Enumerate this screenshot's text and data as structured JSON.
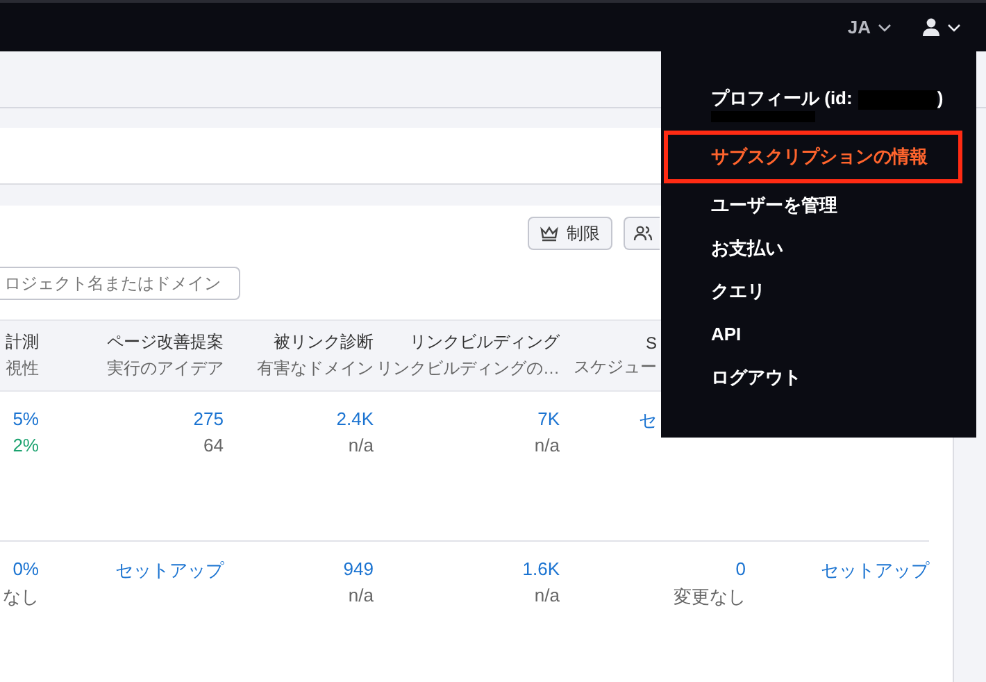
{
  "topbar": {
    "language": "JA"
  },
  "user_menu": {
    "items": [
      {
        "kind": "profile",
        "label": "プロフィール (id:",
        "suffix": ")",
        "selected": false
      },
      {
        "kind": "link",
        "label": "サブスクリプションの情報",
        "selected": true
      },
      {
        "kind": "link",
        "label": "ユーザーを管理",
        "selected": false
      },
      {
        "kind": "link",
        "label": "お支払い",
        "selected": false
      },
      {
        "kind": "link",
        "label": "クエリ",
        "selected": false
      },
      {
        "kind": "link",
        "label": "API",
        "selected": false
      },
      {
        "kind": "link",
        "label": "ログアウト",
        "selected": false
      }
    ]
  },
  "toolbar": {
    "buttons": [
      {
        "kind": "limits",
        "label": "制限"
      },
      {
        "kind": "users"
      }
    ]
  },
  "search": {
    "placeholder": "ロジェクト名またはドメイン"
  },
  "table": {
    "columns": [
      {
        "title": "計測",
        "subtitle": "視性"
      },
      {
        "title": "ページ改善提案",
        "subtitle": "実行のアイデア"
      },
      {
        "title": "被リンク診断",
        "subtitle": "有害なドメイン"
      },
      {
        "title": "リンクビルディング",
        "subtitle": "リンクビルディングの…"
      },
      {
        "title": "S",
        "subtitle": "スケジュー"
      }
    ],
    "rows": [
      {
        "cells": [
          [
            {
              "text": "5%",
              "kind": "link"
            },
            {
              "text": "2%",
              "kind": "positive"
            }
          ],
          [
            {
              "text": "275",
              "kind": "link"
            },
            {
              "text": "64",
              "kind": "muted"
            }
          ],
          [
            {
              "text": "2.4K",
              "kind": "link"
            },
            {
              "text": "n/a",
              "kind": "muted"
            }
          ],
          [
            {
              "text": "7K",
              "kind": "link"
            },
            {
              "text": "n/a",
              "kind": "muted"
            }
          ],
          [
            {
              "text": "セ",
              "kind": "link"
            }
          ]
        ]
      },
      {
        "cells": [
          [
            {
              "text": "0%",
              "kind": "link"
            },
            {
              "text": "なし",
              "kind": "muted"
            }
          ],
          [
            {
              "text": "セットアップ",
              "kind": "link"
            }
          ],
          [
            {
              "text": "949",
              "kind": "link"
            },
            {
              "text": "n/a",
              "kind": "muted"
            }
          ],
          [
            {
              "text": "1.6K",
              "kind": "link"
            },
            {
              "text": "n/a",
              "kind": "muted"
            }
          ],
          [
            {
              "text": "0",
              "kind": "link"
            },
            {
              "text": "変更なし",
              "kind": "muted"
            }
          ],
          [
            {
              "text": "セットアップ",
              "kind": "link"
            }
          ]
        ]
      }
    ]
  }
}
